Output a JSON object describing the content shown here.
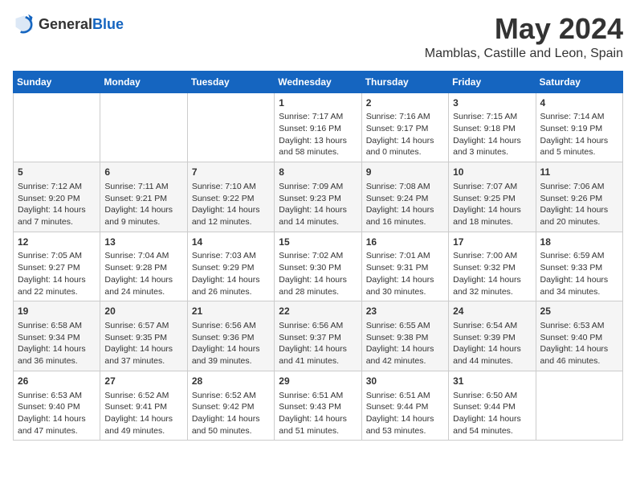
{
  "header": {
    "logo_general": "General",
    "logo_blue": "Blue",
    "title": "May 2024",
    "location": "Mamblas, Castille and Leon, Spain"
  },
  "calendar": {
    "days_of_week": [
      "Sunday",
      "Monday",
      "Tuesday",
      "Wednesday",
      "Thursday",
      "Friday",
      "Saturday"
    ],
    "weeks": [
      [
        {
          "day": "",
          "content": ""
        },
        {
          "day": "",
          "content": ""
        },
        {
          "day": "",
          "content": ""
        },
        {
          "day": "1",
          "content": "Sunrise: 7:17 AM\nSunset: 9:16 PM\nDaylight: 13 hours\nand 58 minutes."
        },
        {
          "day": "2",
          "content": "Sunrise: 7:16 AM\nSunset: 9:17 PM\nDaylight: 14 hours\nand 0 minutes."
        },
        {
          "day": "3",
          "content": "Sunrise: 7:15 AM\nSunset: 9:18 PM\nDaylight: 14 hours\nand 3 minutes."
        },
        {
          "day": "4",
          "content": "Sunrise: 7:14 AM\nSunset: 9:19 PM\nDaylight: 14 hours\nand 5 minutes."
        }
      ],
      [
        {
          "day": "5",
          "content": "Sunrise: 7:12 AM\nSunset: 9:20 PM\nDaylight: 14 hours\nand 7 minutes."
        },
        {
          "day": "6",
          "content": "Sunrise: 7:11 AM\nSunset: 9:21 PM\nDaylight: 14 hours\nand 9 minutes."
        },
        {
          "day": "7",
          "content": "Sunrise: 7:10 AM\nSunset: 9:22 PM\nDaylight: 14 hours\nand 12 minutes."
        },
        {
          "day": "8",
          "content": "Sunrise: 7:09 AM\nSunset: 9:23 PM\nDaylight: 14 hours\nand 14 minutes."
        },
        {
          "day": "9",
          "content": "Sunrise: 7:08 AM\nSunset: 9:24 PM\nDaylight: 14 hours\nand 16 minutes."
        },
        {
          "day": "10",
          "content": "Sunrise: 7:07 AM\nSunset: 9:25 PM\nDaylight: 14 hours\nand 18 minutes."
        },
        {
          "day": "11",
          "content": "Sunrise: 7:06 AM\nSunset: 9:26 PM\nDaylight: 14 hours\nand 20 minutes."
        }
      ],
      [
        {
          "day": "12",
          "content": "Sunrise: 7:05 AM\nSunset: 9:27 PM\nDaylight: 14 hours\nand 22 minutes."
        },
        {
          "day": "13",
          "content": "Sunrise: 7:04 AM\nSunset: 9:28 PM\nDaylight: 14 hours\nand 24 minutes."
        },
        {
          "day": "14",
          "content": "Sunrise: 7:03 AM\nSunset: 9:29 PM\nDaylight: 14 hours\nand 26 minutes."
        },
        {
          "day": "15",
          "content": "Sunrise: 7:02 AM\nSunset: 9:30 PM\nDaylight: 14 hours\nand 28 minutes."
        },
        {
          "day": "16",
          "content": "Sunrise: 7:01 AM\nSunset: 9:31 PM\nDaylight: 14 hours\nand 30 minutes."
        },
        {
          "day": "17",
          "content": "Sunrise: 7:00 AM\nSunset: 9:32 PM\nDaylight: 14 hours\nand 32 minutes."
        },
        {
          "day": "18",
          "content": "Sunrise: 6:59 AM\nSunset: 9:33 PM\nDaylight: 14 hours\nand 34 minutes."
        }
      ],
      [
        {
          "day": "19",
          "content": "Sunrise: 6:58 AM\nSunset: 9:34 PM\nDaylight: 14 hours\nand 36 minutes."
        },
        {
          "day": "20",
          "content": "Sunrise: 6:57 AM\nSunset: 9:35 PM\nDaylight: 14 hours\nand 37 minutes."
        },
        {
          "day": "21",
          "content": "Sunrise: 6:56 AM\nSunset: 9:36 PM\nDaylight: 14 hours\nand 39 minutes."
        },
        {
          "day": "22",
          "content": "Sunrise: 6:56 AM\nSunset: 9:37 PM\nDaylight: 14 hours\nand 41 minutes."
        },
        {
          "day": "23",
          "content": "Sunrise: 6:55 AM\nSunset: 9:38 PM\nDaylight: 14 hours\nand 42 minutes."
        },
        {
          "day": "24",
          "content": "Sunrise: 6:54 AM\nSunset: 9:39 PM\nDaylight: 14 hours\nand 44 minutes."
        },
        {
          "day": "25",
          "content": "Sunrise: 6:53 AM\nSunset: 9:40 PM\nDaylight: 14 hours\nand 46 minutes."
        }
      ],
      [
        {
          "day": "26",
          "content": "Sunrise: 6:53 AM\nSunset: 9:40 PM\nDaylight: 14 hours\nand 47 minutes."
        },
        {
          "day": "27",
          "content": "Sunrise: 6:52 AM\nSunset: 9:41 PM\nDaylight: 14 hours\nand 49 minutes."
        },
        {
          "day": "28",
          "content": "Sunrise: 6:52 AM\nSunset: 9:42 PM\nDaylight: 14 hours\nand 50 minutes."
        },
        {
          "day": "29",
          "content": "Sunrise: 6:51 AM\nSunset: 9:43 PM\nDaylight: 14 hours\nand 51 minutes."
        },
        {
          "day": "30",
          "content": "Sunrise: 6:51 AM\nSunset: 9:44 PM\nDaylight: 14 hours\nand 53 minutes."
        },
        {
          "day": "31",
          "content": "Sunrise: 6:50 AM\nSunset: 9:44 PM\nDaylight: 14 hours\nand 54 minutes."
        },
        {
          "day": "",
          "content": ""
        }
      ]
    ]
  }
}
